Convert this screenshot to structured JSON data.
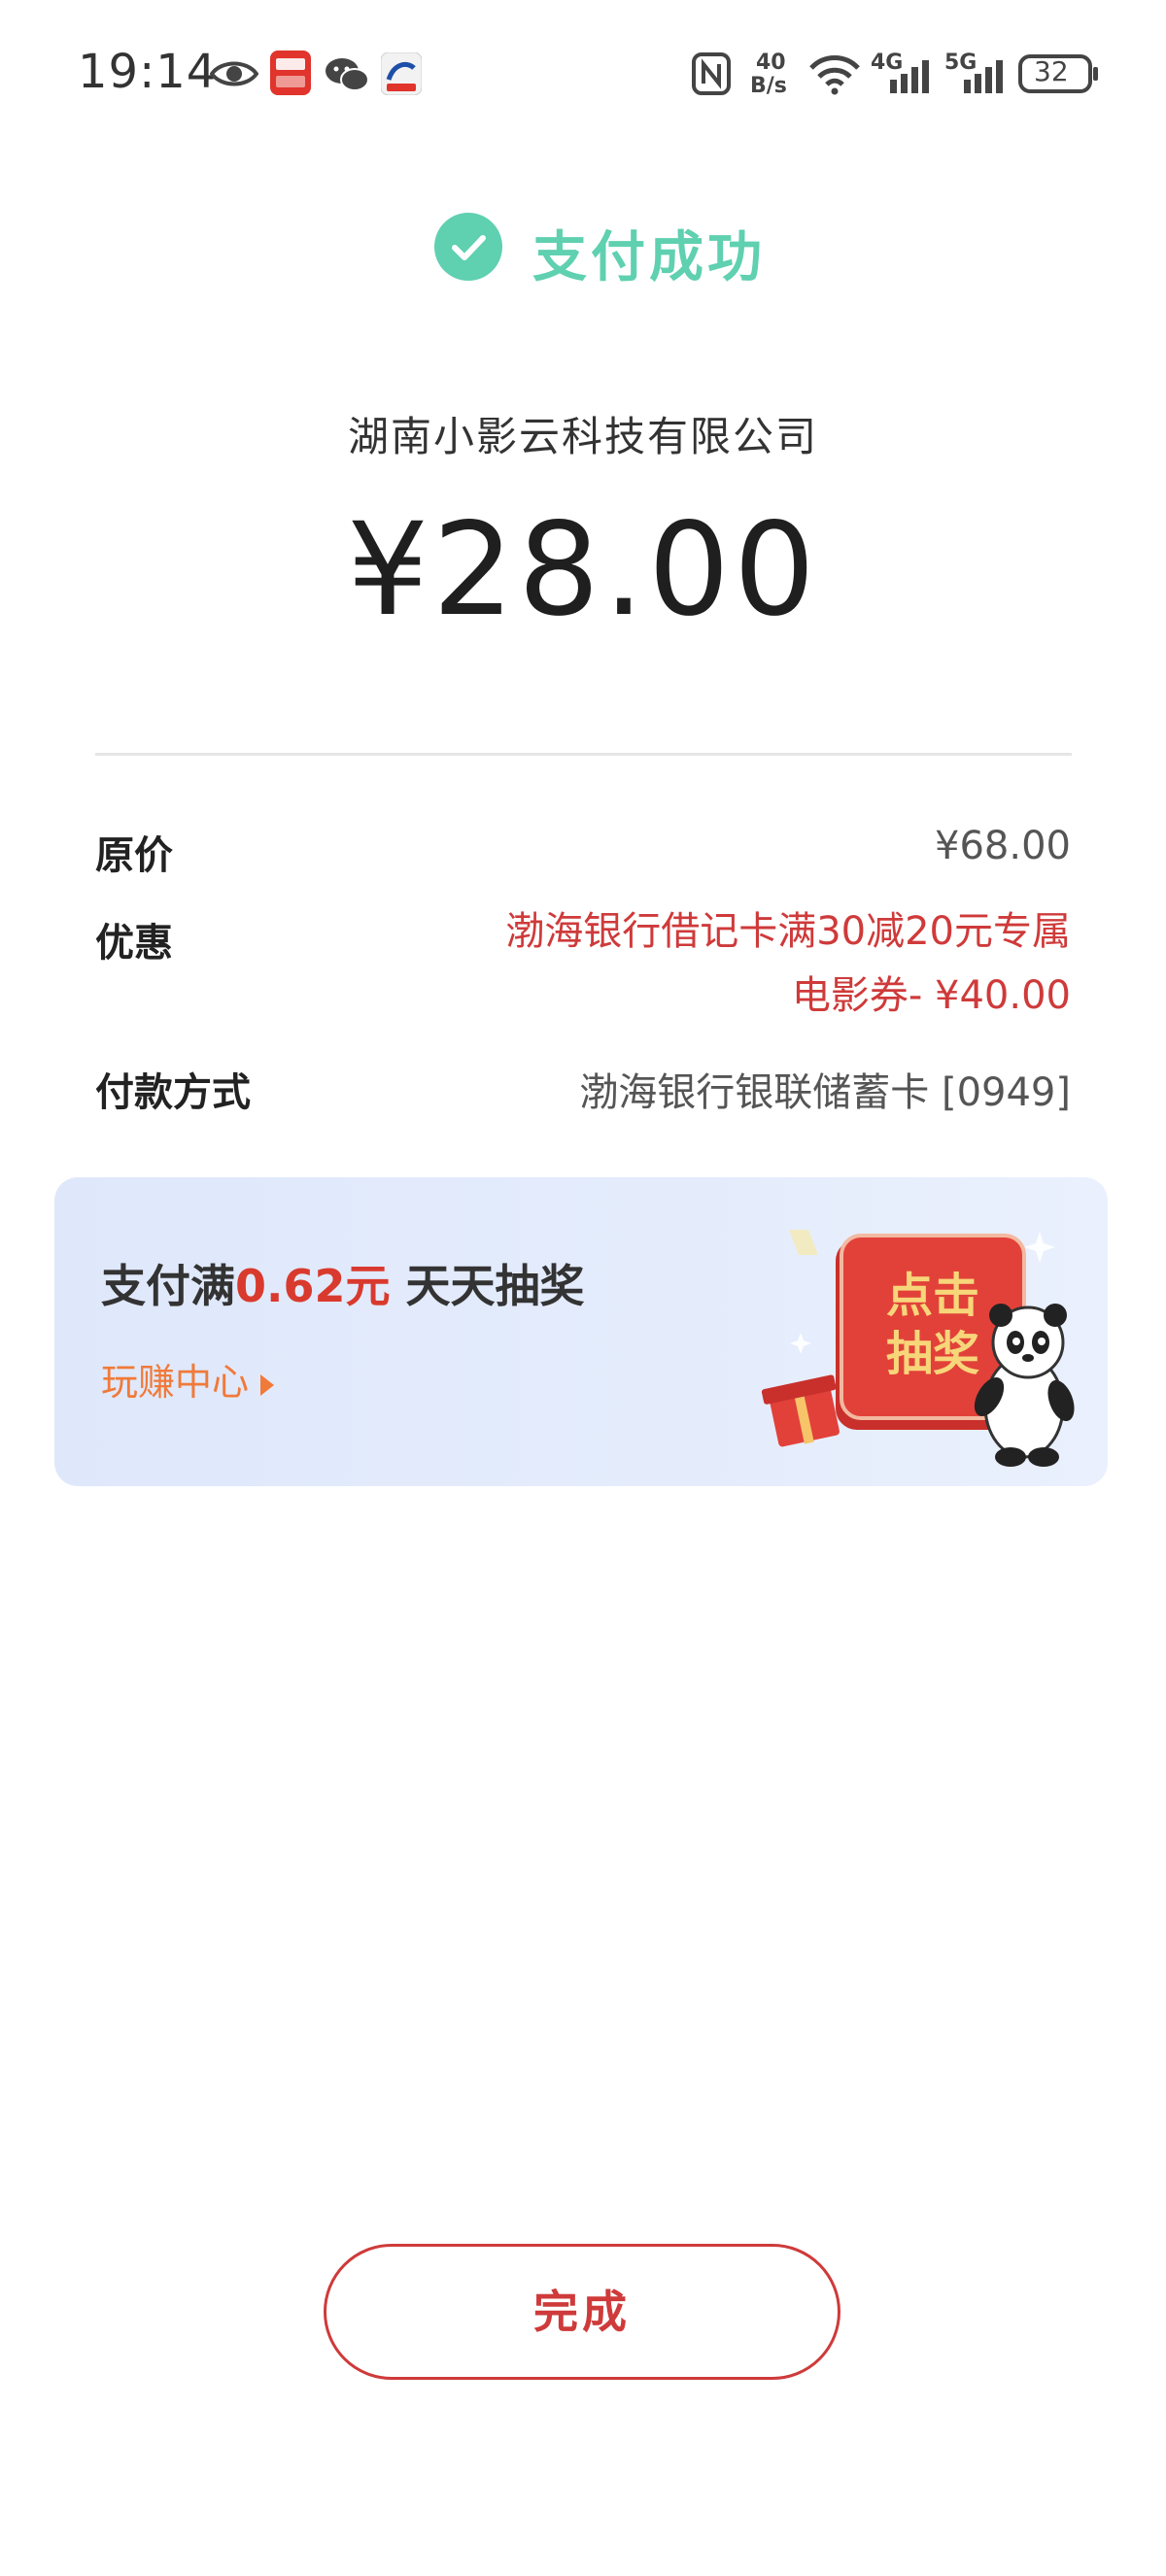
{
  "status_bar": {
    "time": "19:14",
    "net_speed_value": "40",
    "net_speed_unit": "B/s",
    "signal_4g": "4G",
    "signal_5g": "5G",
    "battery": "32",
    "icons": [
      "eye-icon",
      "app-icon-red",
      "wechat-icon",
      "app-icon-blue",
      "nfc-icon",
      "wifi-icon",
      "signal-icon",
      "battery-icon"
    ]
  },
  "header": {
    "status_text": "支付成功",
    "status_color": "#5fd0b0"
  },
  "payment": {
    "merchant": "湖南小影云科技有限公司",
    "amount": "¥28.00"
  },
  "details": {
    "original_price_label": "原价",
    "original_price_value": "¥68.00",
    "discount_label": "优惠",
    "discount_line1": "渤海银行借记卡满30减20元专属",
    "discount_line2": "电影券- ¥40.00",
    "method_label": "付款方式",
    "method_value": "渤海银行银联储蓄卡 [0949]"
  },
  "promo": {
    "prefix": "支付满",
    "amount": "0.62元",
    "suffix": " 天天抽奖",
    "link_label": "玩赚中心",
    "badge_line1": "点击",
    "badge_line2": "抽奖",
    "accent_color": "#d93a2e"
  },
  "footer": {
    "done_label": "完成",
    "button_color": "#cf3a3a"
  }
}
